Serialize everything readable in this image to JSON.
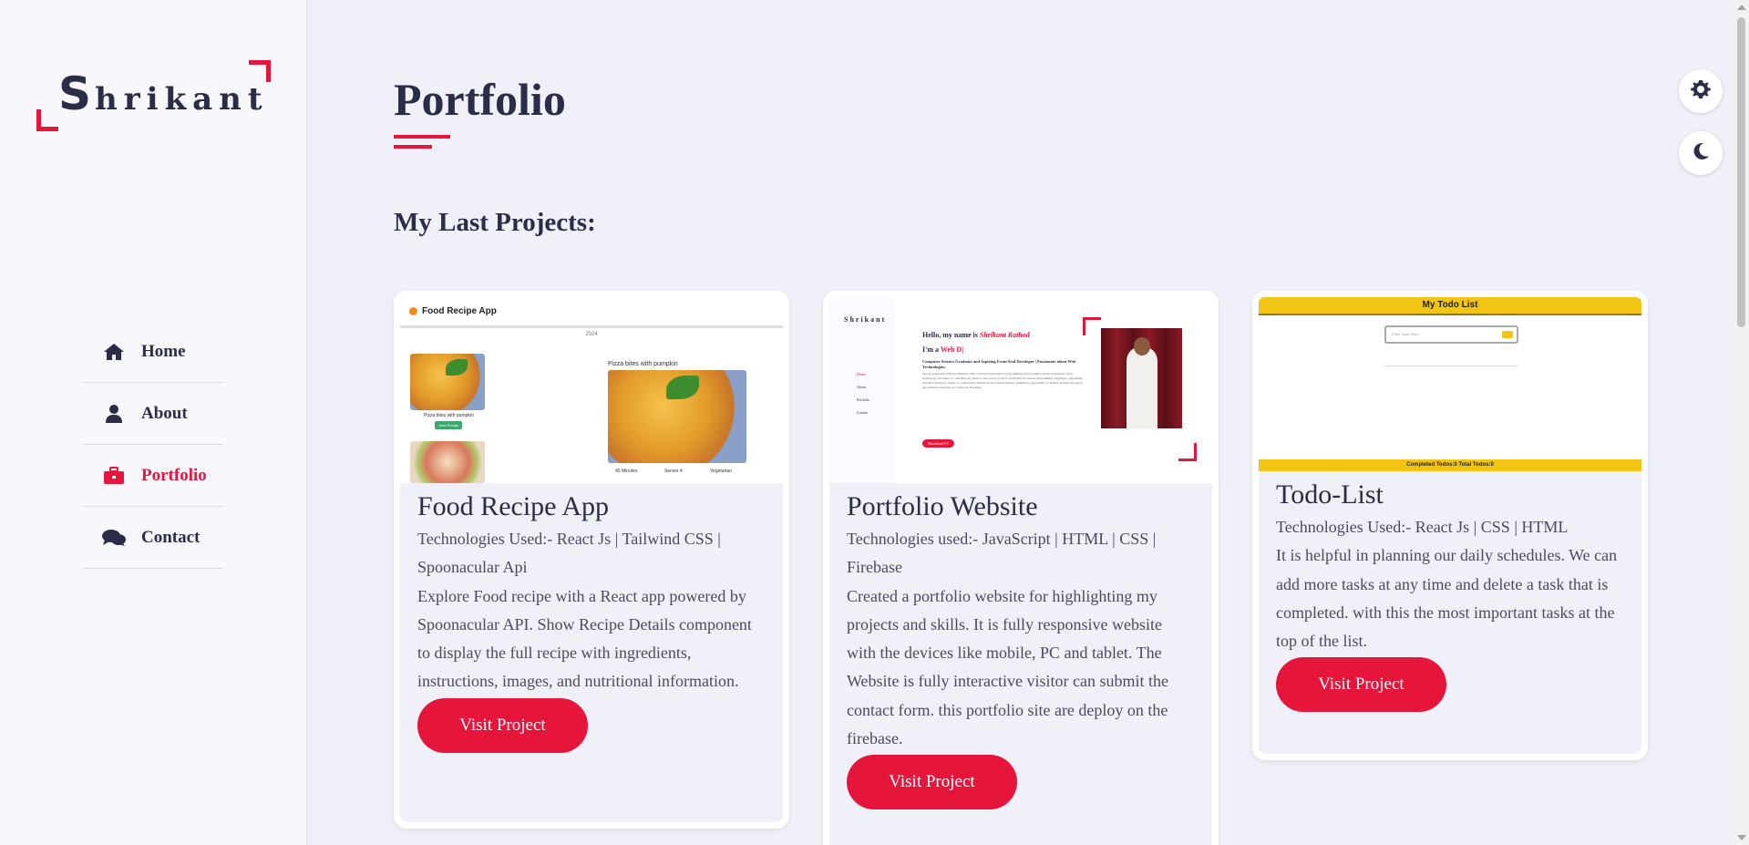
{
  "sidebar": {
    "logo": {
      "first_letter": "S",
      "rest": "hrikant"
    },
    "nav": [
      {
        "label": "Home",
        "icon": "home-icon",
        "active": false
      },
      {
        "label": "About",
        "icon": "user-icon",
        "active": false
      },
      {
        "label": "Portfolio",
        "icon": "briefcase-icon",
        "active": true
      },
      {
        "label": "Contact",
        "icon": "comments-icon",
        "active": false
      }
    ]
  },
  "main": {
    "title": "Portfolio",
    "subtitle": "My Last Projects:",
    "projects": [
      {
        "title": "Food Recipe App",
        "tech": "Technologies Used:- React Js | Tailwind CSS | Spoonacular Api",
        "description": "Explore Food recipe with a React app powered by Spoonacular API. Show Recipe Details component to display the full recipe with ingredients, instructions, images, and nutritional information.",
        "button": "Visit Project",
        "thumb": {
          "header": "Food Recipe App",
          "item1": "Pizza bites with pumpkin",
          "detail_title": "Pizza bites with pumpkin",
          "view_btn": "View Recipe",
          "minutes": "45 Minutes",
          "serves": "Serves 4",
          "veg": "Vegetarian"
        }
      },
      {
        "title": "Portfolio Website",
        "tech": "Technologies used:- JavaScript | HTML | CSS | Firebase",
        "description": "Created a portfolio website for highlighting my projects and skills. It is fully responsive website with the devices like mobile, PC and tablet. The Website is fully interactive visitor can submit the contact form. this portfolio site are deploy on the firebase.",
        "button": "Visit Project",
        "thumb": {
          "logo": "Shrikant",
          "hello": "Hello, my name is",
          "name": "Shrikant Rathod",
          "im": "I'm a",
          "role": "Web D|",
          "headline": "Computer Science Graduate and Aspiring Front-End Developer | Passionate about Web Technologies.",
          "bio": "Newly graduated Software Engineer with a strong foundation in programming and problem-solving. Passionate about technology and eager to contribute my skills to innovative projects. Proficient in various programming languages, algorithms, and data structures. Adept at collaborative teamwork and quick learning. Seeking an opportunity to further develop and apply my technical expertise as a Software Engineer.",
          "download": "Download CV",
          "nav": [
            "Home",
            "About",
            "Portfolio",
            "Contact"
          ]
        }
      },
      {
        "title": "Todo-List",
        "tech": "Technologies Used:- React Js | CSS | HTML",
        "description": "It is helpful in planning our daily schedules. We can add more tasks at any time and delete a task that is completed. with this the most important tasks at the top of the list.",
        "button": "Visit Project",
        "thumb": {
          "header": "My Todo List",
          "placeholder": "Enter Task Here...",
          "footer": "Completed Todos:0       Total Todos:0"
        }
      }
    ]
  },
  "controls": {
    "settings": "gear-icon",
    "theme": "moon-icon"
  },
  "colors": {
    "accent": "#e6153b",
    "dark": "#2b2c48",
    "bg": "#f0f0f8"
  }
}
